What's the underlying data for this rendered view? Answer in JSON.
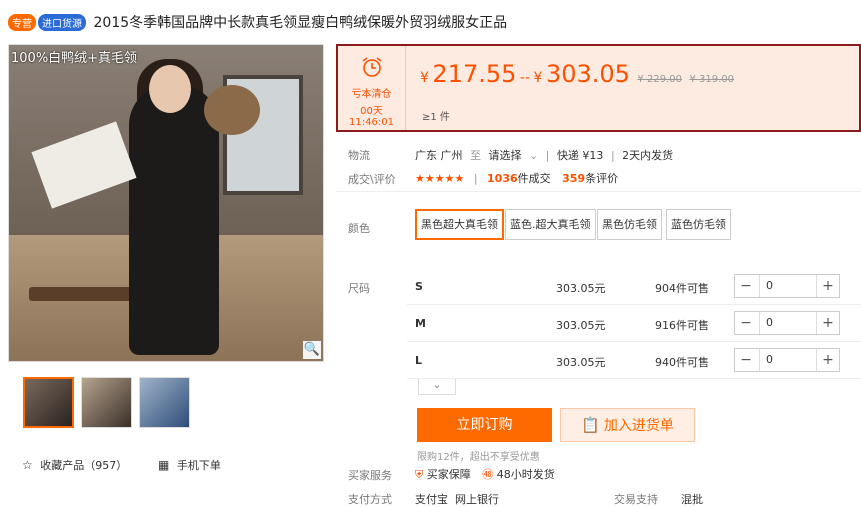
{
  "header": {
    "tag_self": "专营",
    "tag_import": "进口货源",
    "title": "2015冬季韩国品牌中长款真毛领显瘦白鸭绒保暖外贸羽绒服女正品"
  },
  "gallery": {
    "image_label": "100%白鸭绒+真毛领",
    "zoom_icon": "magnifier-icon"
  },
  "actions": {
    "favorite_label": "收藏产品（957）",
    "mobile_order_label": "手机下单"
  },
  "price": {
    "promo_label": "亏本清仓",
    "countdown": "00天11:46:01",
    "yen": "¥",
    "low": "217.55",
    "separator": "--",
    "high": "303.05",
    "old_low": "¥ 229.00",
    "old_high": "¥ 319.00",
    "min_qty": "≥1 件"
  },
  "shipping": {
    "label": "物流",
    "from": "广东 广州",
    "to_label": "至",
    "select_label": "请选择",
    "express": "快递 ¥13",
    "ship_time": "2天内发货"
  },
  "deals": {
    "label": "成交\\评价",
    "stars": "★★★★★",
    "count": "1036",
    "count_suffix": "件成交",
    "reviews": "359",
    "reviews_suffix": "条评价"
  },
  "colors": {
    "label": "颜色",
    "options": [
      "黑色超大真毛领",
      "蓝色.超大真毛领",
      "黑色仿毛领",
      "蓝色仿毛领"
    ]
  },
  "sizes": {
    "label": "尺码",
    "rows": [
      {
        "name": "S",
        "price": "303.05元",
        "stock": "904件可售",
        "qty": "0"
      },
      {
        "name": "M",
        "price": "303.05元",
        "stock": "916件可售",
        "qty": "0"
      },
      {
        "name": "L",
        "price": "303.05元",
        "stock": "940件可售",
        "qty": "0"
      }
    ],
    "minus": "−",
    "plus": "+"
  },
  "buttons": {
    "buy": "立即订购",
    "cart": "加入进货单"
  },
  "limit_note": "限购12件，超出不享受优惠",
  "service": {
    "label": "买家服务",
    "guarantee": "买家保障",
    "delivery": "48小时发货"
  },
  "payment": {
    "label": "支付方式",
    "methods": "支付宝  网上银行",
    "trade_label": "交易支持",
    "trade_value": "混批"
  }
}
